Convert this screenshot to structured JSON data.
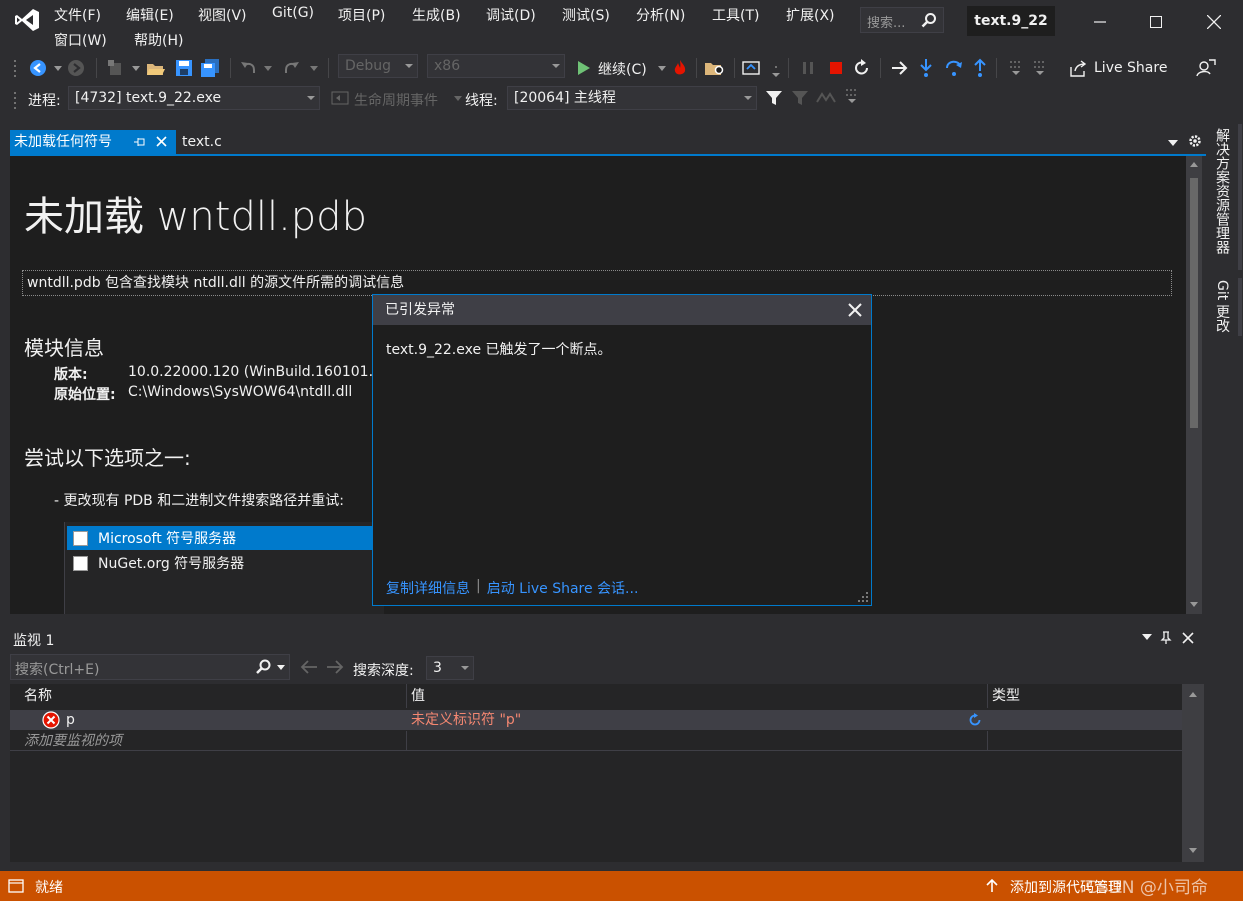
{
  "menu": {
    "row1": [
      "文件(F)",
      "编辑(E)",
      "视图(V)",
      "Git(G)",
      "项目(P)",
      "生成(B)",
      "调试(D)",
      "测试(S)",
      "分析(N)",
      "工具(T)",
      "扩展(X)"
    ],
    "row2": [
      "窗口(W)",
      "帮助(H)"
    ]
  },
  "search": {
    "placeholder": "搜索..."
  },
  "solution_title": "text.9_22",
  "toolbar": {
    "config": "Debug",
    "platform": "x86",
    "continue_label": "继续(C)",
    "live_share": "Live Share",
    "process_label": "进程:",
    "process_value": "[4732] text.9_22.exe",
    "lifecycle_label": "生命周期事件",
    "thread_label": "线程:",
    "thread_value": "[20064] 主线程"
  },
  "tabs": {
    "active": "未加载任何符号",
    "second": "text.c"
  },
  "doc": {
    "title": "未加载 wntdll.pdb",
    "description": "wntdll.pdb 包含查找模块 ntdll.dll 的源文件所需的调试信息",
    "module_info_heading": "模块信息",
    "version_label": "版本:",
    "version_value": "10.0.22000.120 (WinBuild.160101.",
    "location_label": "原始位置:",
    "location_value": "C:\\Windows\\SysWOW64\\ntdll.dll",
    "try_heading": "尝试以下选项之一:",
    "option_text": "- 更改现有 PDB 和二进制文件搜索路径并重试:",
    "symbol_servers": [
      "Microsoft 符号服务器",
      "NuGet.org 符号服务器"
    ]
  },
  "side_panel": [
    "解决方案资源管理器",
    "Git 更改"
  ],
  "exception": {
    "title": "已引发异常",
    "message": "text.9_22.exe 已触发了一个断点。",
    "link_copy": "复制详细信息",
    "link_liveshare": "启动 Live Share 会话..."
  },
  "watch": {
    "title": "监视 1",
    "search_placeholder": "搜索(Ctrl+E)",
    "depth_label": "搜索深度:",
    "depth_value": "3",
    "columns": [
      "名称",
      "值",
      "类型"
    ],
    "rows": [
      {
        "name": "p",
        "value": "未定义标识符 \"p\"",
        "type": ""
      }
    ],
    "add_hint": "添加要监视的项"
  },
  "status": {
    "left": "就绪",
    "right": "添加到源代码管理",
    "watermark": "CSDN @小司命"
  },
  "colors": {
    "accent": "#007acc",
    "status_bar": "#ca5100",
    "error_value": "#f48771",
    "link": "#3794ff"
  }
}
